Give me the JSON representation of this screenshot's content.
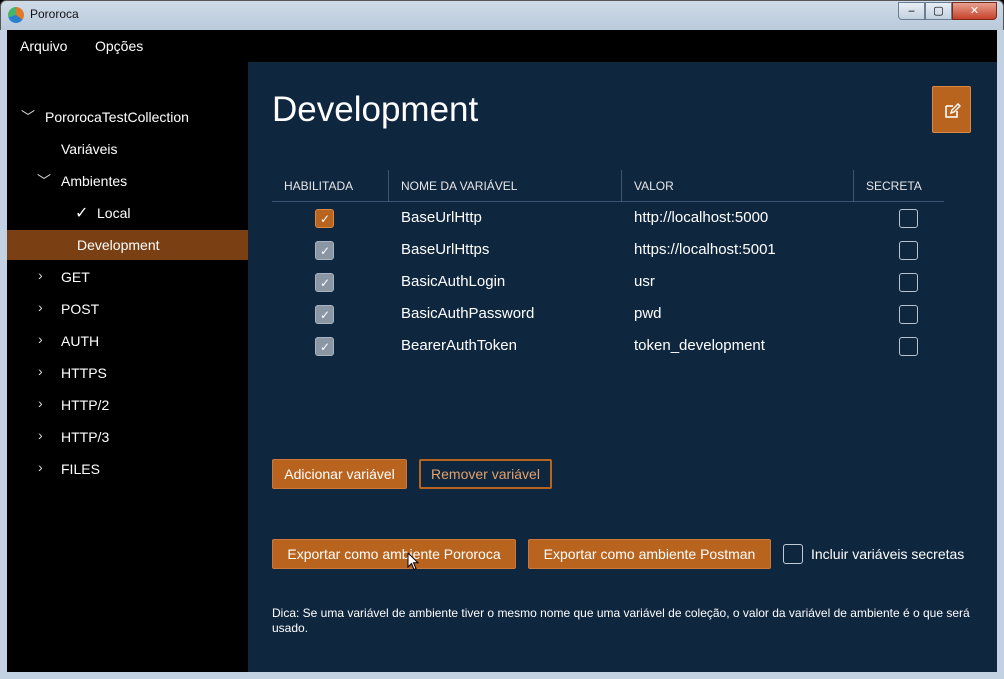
{
  "window": {
    "title": "Pororoca",
    "min": "‒",
    "max": "▢",
    "close": "✕"
  },
  "menu": {
    "items": [
      "Arquivo",
      "Opções"
    ]
  },
  "sidebar": {
    "collection": "PororocaTestCollection",
    "variables": "Variáveis",
    "environments": "Ambientes",
    "env_local": "Local",
    "env_active_mark": "✓",
    "env_development": "Development",
    "folders": [
      "GET",
      "POST",
      "AUTH",
      "HTTPS",
      "HTTP/2",
      "HTTP/3",
      "FILES"
    ]
  },
  "main": {
    "title": "Development",
    "table": {
      "headers": [
        "HABILITADA",
        "NOME DA VARIÁVEL",
        "VALOR",
        "SECRETA"
      ],
      "rows": [
        {
          "enabled": true,
          "name": "BaseUrlHttp",
          "value": "http://localhost:5000",
          "secret": false
        },
        {
          "enabled": true,
          "name": "BaseUrlHttps",
          "value": "https://localhost:5001",
          "secret": false
        },
        {
          "enabled": true,
          "name": "BasicAuthLogin",
          "value": "usr",
          "secret": false
        },
        {
          "enabled": true,
          "name": "BasicAuthPassword",
          "value": "pwd",
          "secret": false
        },
        {
          "enabled": true,
          "name": "BearerAuthToken",
          "value": "token_development",
          "secret": false
        }
      ]
    },
    "buttons": {
      "add": "Adicionar variável",
      "remove": "Remover variável",
      "export_pororoca": "Exportar como ambiente Pororoca",
      "export_postman": "Exportar como ambiente Postman"
    },
    "include_secrets_label": "Incluir variáveis secretas",
    "tip": "Dica: Se uma variável de ambiente tiver o mesmo nome que uma variável de coleção, o valor da variável de ambiente é o que será usado."
  },
  "colors": {
    "accent": "#b8641f",
    "panel": "#0f263f",
    "selected": "#7a4014"
  }
}
